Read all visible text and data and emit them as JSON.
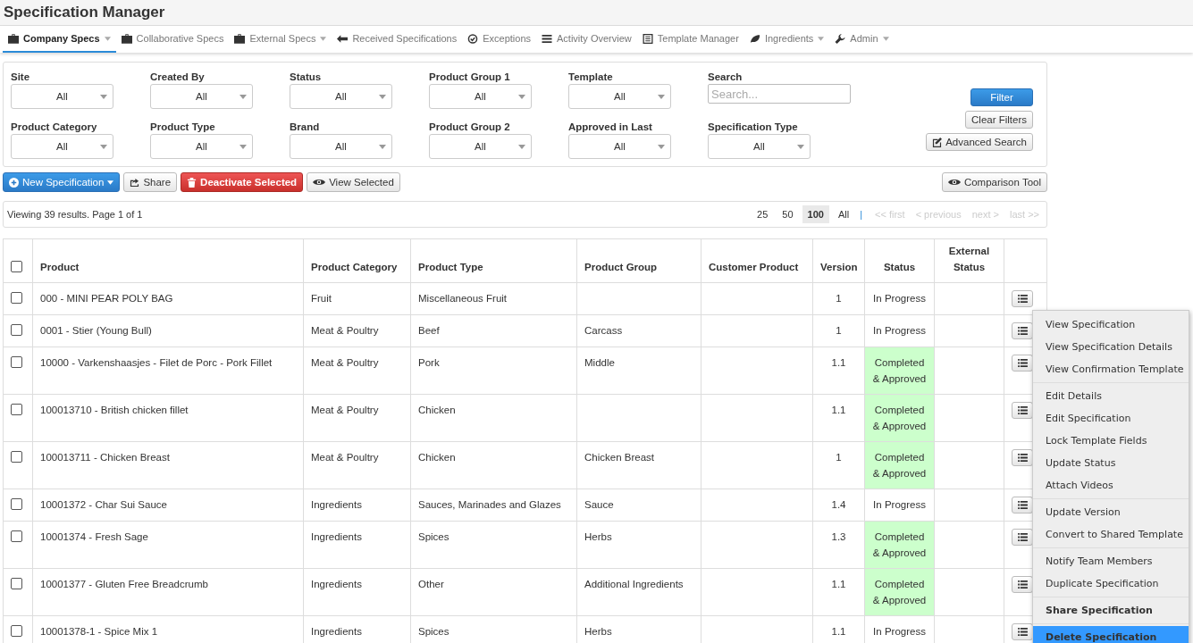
{
  "title": "Specification Manager",
  "nav": [
    {
      "label": "Company Specs",
      "has_menu": true,
      "selected": true
    },
    {
      "label": "Collaborative Specs",
      "has_menu": false,
      "selected": false
    },
    {
      "label": "External Specs",
      "has_menu": true,
      "selected": false
    },
    {
      "label": "Received Specifications",
      "has_menu": false,
      "selected": false
    },
    {
      "label": "Exceptions",
      "has_menu": false,
      "selected": false
    },
    {
      "label": "Activity Overview",
      "has_menu": false,
      "selected": false
    },
    {
      "label": "Template Manager",
      "has_menu": false,
      "selected": false
    },
    {
      "label": "Ingredients",
      "has_menu": true,
      "selected": false
    },
    {
      "label": "Admin",
      "has_menu": true,
      "selected": false
    }
  ],
  "filters": [
    {
      "kind": "select",
      "label": "Site",
      "value": "All"
    },
    {
      "kind": "select",
      "label": "Created By",
      "value": "All"
    },
    {
      "kind": "select",
      "label": "Status",
      "value": "All"
    },
    {
      "kind": "select",
      "label": "Product Group 1",
      "value": "All"
    },
    {
      "kind": "select",
      "label": "Template",
      "value": "All"
    },
    {
      "kind": "search",
      "label": "Search",
      "placeholder": "Search..."
    },
    {
      "kind": "select",
      "label": "Product Category",
      "value": "All"
    },
    {
      "kind": "select",
      "label": "Product Type",
      "value": "All"
    },
    {
      "kind": "select",
      "label": "Brand",
      "value": "All"
    },
    {
      "kind": "select",
      "label": "Product Group 2",
      "value": "All"
    },
    {
      "kind": "select",
      "label": "Approved in Last",
      "value": "All"
    },
    {
      "kind": "select",
      "label": "Specification Type",
      "value": "All"
    }
  ],
  "filter_buttons": [
    {
      "kind": "primary",
      "label": "Filter"
    },
    {
      "kind": "plain",
      "label": "Clear Filters"
    },
    {
      "kind": "edit",
      "label": "Advanced Search"
    }
  ],
  "toolbar": [
    {
      "kind": "new",
      "label": "New Specification"
    },
    {
      "kind": "share",
      "label": "Share"
    },
    {
      "kind": "delete",
      "label": "Deactivate Selected"
    },
    {
      "kind": "view",
      "label": "View Selected"
    }
  ],
  "comparison_button": "Comparison Tool",
  "pagination": {
    "summary": "Viewing 39 results. Page 1 of 1",
    "page_sizes": [
      {
        "label": "25",
        "selected": false
      },
      {
        "label": "50",
        "selected": false
      },
      {
        "label": "100",
        "selected": true
      },
      {
        "label": "All",
        "selected": false
      }
    ],
    "separator": "|",
    "links": [
      {
        "label": "<< first",
        "disabled": true
      },
      {
        "label": "< previous",
        "disabled": true
      },
      {
        "label": "next >",
        "disabled": true
      },
      {
        "label": "last >>",
        "disabled": true
      }
    ]
  },
  "table": {
    "header_checked": false,
    "columns": [
      "Product",
      "Product Category",
      "Product Type",
      "Product Group",
      "Customer Product",
      "Version",
      "Status",
      "External Status"
    ],
    "rows": [
      {
        "checked": false,
        "product": "000 - MINI PEAR POLY BAG",
        "category": "Fruit",
        "type": "Miscellaneous Fruit",
        "group": "",
        "version": "1",
        "status": [
          "In Progress"
        ],
        "approved": false
      },
      {
        "checked": false,
        "product": "0001 - Stier (Young Bull)",
        "category": "Meat & Poultry",
        "type": "Beef",
        "group": "Carcass",
        "version": "1",
        "status": [
          "In Progress"
        ],
        "approved": false
      },
      {
        "checked": false,
        "product": "10000 - Varkenshaasjes - Filet de Porc - Pork Fillet",
        "category": "Meat & Poultry",
        "type": "Pork",
        "group": "Middle",
        "version": "1.1",
        "status": [
          "Completed",
          "& Approved"
        ],
        "approved": true
      },
      {
        "checked": false,
        "product": "100013710 - British chicken fillet",
        "category": "Meat & Poultry",
        "type": "Chicken",
        "group": "",
        "version": "1.1",
        "status": [
          "Completed",
          "& Approved"
        ],
        "approved": true
      },
      {
        "checked": false,
        "product": "100013711 - Chicken Breast",
        "category": "Meat & Poultry",
        "type": "Chicken",
        "group": "Chicken Breast",
        "version": "1",
        "status": [
          "Completed",
          "& Approved"
        ],
        "approved": true
      },
      {
        "checked": false,
        "product": "10001372 - Char Sui Sauce",
        "category": "Ingredients",
        "type": "Sauces, Marinades and Glazes",
        "group": "Sauce",
        "version": "1.4",
        "status": [
          "In Progress"
        ],
        "approved": false
      },
      {
        "checked": false,
        "product": "10001374 - Fresh Sage",
        "category": "Ingredients",
        "type": "Spices",
        "group": "Herbs",
        "version": "1.3",
        "status": [
          "Completed",
          "& Approved"
        ],
        "approved": true
      },
      {
        "checked": false,
        "product": "10001377 - Gluten Free Breadcrumb",
        "category": "Ingredients",
        "type": "Other",
        "group": "Additional Ingredients",
        "version": "1.1",
        "status": [
          "Completed",
          "& Approved"
        ],
        "approved": true
      },
      {
        "checked": false,
        "product": "10001378-1 - Spice Mix 1",
        "category": "Ingredients",
        "type": "Spices",
        "group": "Herbs",
        "version": "1.1",
        "status": [
          "In Progress"
        ],
        "approved": false
      }
    ]
  },
  "context_menu": [
    [
      {
        "label": "View Specification",
        "bold": false,
        "selected": false
      },
      {
        "label": "View Specification Details",
        "bold": false,
        "selected": false
      },
      {
        "label": "View Confirmation Template",
        "bold": false,
        "selected": false
      }
    ],
    [
      {
        "label": "Edit Details",
        "bold": false,
        "selected": false
      },
      {
        "label": "Edit Specification",
        "bold": false,
        "selected": false
      },
      {
        "label": "Lock Template Fields",
        "bold": false,
        "selected": false
      },
      {
        "label": "Update Status",
        "bold": false,
        "selected": false
      },
      {
        "label": "Attach Videos",
        "bold": false,
        "selected": false
      }
    ],
    [
      {
        "label": "Update Version",
        "bold": false,
        "selected": false
      },
      {
        "label": "Convert to Shared Template",
        "bold": false,
        "selected": false
      }
    ],
    [
      {
        "label": "Notify Team Members",
        "bold": false,
        "selected": false
      },
      {
        "label": "Duplicate Specification",
        "bold": false,
        "selected": false
      }
    ],
    [
      {
        "label": "Share Specification",
        "bold": true,
        "selected": false
      }
    ],
    [
      {
        "label": "Delete Specification",
        "bold": true,
        "selected": true
      }
    ]
  ]
}
